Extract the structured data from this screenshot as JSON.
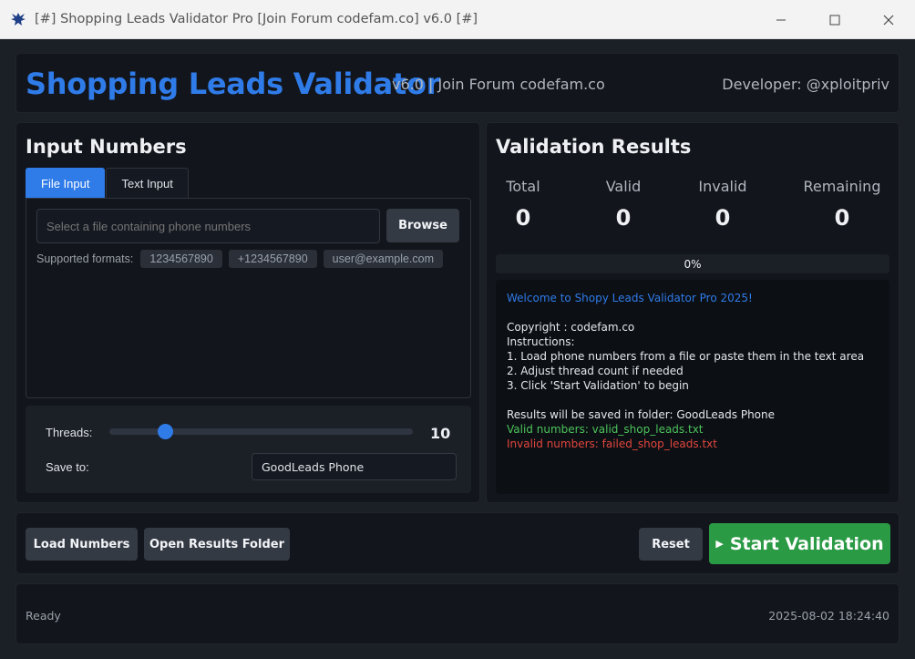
{
  "window": {
    "title": "[#] Shopping Leads Validator Pro [Join Forum codefam.co] v6.0 [#]"
  },
  "header": {
    "title": "Shopping Leads Validator",
    "version": "v6.0 | Join Forum codefam.co",
    "developer": "Developer: @xploitpriv"
  },
  "input": {
    "title": "Input Numbers",
    "tabs": [
      {
        "label": "File Input",
        "active": true
      },
      {
        "label": "Text Input",
        "active": false
      }
    ],
    "file_placeholder": "Select a file containing phone numbers",
    "browse_label": "Browse",
    "formats_label": "Supported formats:",
    "formats": [
      "1234567890",
      "+1234567890",
      "user@example.com"
    ],
    "threads_label": "Threads:",
    "threads_value": "10",
    "threads_min": 1,
    "threads_max": 50,
    "save_label": "Save to:",
    "save_value": "GoodLeads Phone"
  },
  "results": {
    "title": "Validation Results",
    "stats": [
      {
        "label": "Total",
        "value": "0"
      },
      {
        "label": "Valid",
        "value": "0"
      },
      {
        "label": "Invalid",
        "value": "0"
      },
      {
        "label": "Remaining",
        "value": "0"
      }
    ],
    "progress_percent": 0,
    "progress_text": "0%",
    "log": [
      {
        "text": "Welcome to Shopy Leads Validator Pro 2025!",
        "color": "#2f7be8"
      },
      {
        "text": "",
        "color": "#e6e8eb"
      },
      {
        "text": "Copyright : codefam.co",
        "color": "#e6e8eb"
      },
      {
        "text": "Instructions:",
        "color": "#e6e8eb"
      },
      {
        "text": "1. Load phone numbers from a file or paste them in the text area",
        "color": "#e6e8eb"
      },
      {
        "text": "2. Adjust thread count if needed",
        "color": "#e6e8eb"
      },
      {
        "text": "3. Click 'Start Validation' to begin",
        "color": "#e6e8eb"
      },
      {
        "text": "",
        "color": "#e6e8eb"
      },
      {
        "text": "Results will be saved in folder: GoodLeads Phone",
        "color": "#e6e8eb"
      },
      {
        "text": "Valid numbers: valid_shop_leads.txt",
        "color": "#4cc35a"
      },
      {
        "text": "Invalid numbers: failed_shop_leads.txt",
        "color": "#e0463e"
      }
    ]
  },
  "actions": {
    "load_label": "Load Numbers",
    "open_label": "Open Results Folder",
    "reset_label": "Reset",
    "start_label": "Start Validation"
  },
  "status": {
    "text": "Ready",
    "timestamp": "2025-08-02 18:24:40"
  },
  "colors": {
    "accent": "#2f7be8",
    "start": "#2b9a44",
    "valid": "#4cc35a",
    "invalid": "#e0463e"
  }
}
